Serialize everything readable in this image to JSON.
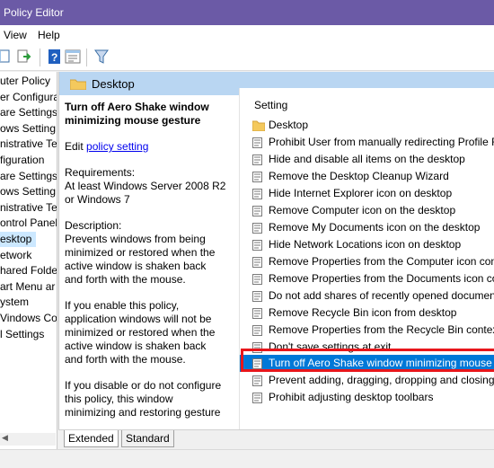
{
  "window": {
    "title": "Policy Editor"
  },
  "menu": {
    "view": "View",
    "help": "Help"
  },
  "tree": {
    "items": [
      "uter Policy",
      "er Configura",
      "are Settings",
      "ows Setting",
      "nistrative Te",
      "figuration",
      "are Settings",
      "ows Setting",
      "nistrative Te",
      "ontrol Panel",
      "esktop",
      "etwork",
      "hared Folder",
      "art Menu ar",
      "ystem",
      "Vindows Cor",
      "l Settings"
    ],
    "selected_index": 10
  },
  "header": {
    "title": "Desktop"
  },
  "description": {
    "title": "Turn off Aero Shake window minimizing mouse gesture",
    "edit_prefix": "Edit ",
    "edit_link": "policy setting",
    "requirements": "Requirements:\nAt least Windows Server 2008 R2 or Windows 7",
    "description": "Description:\nPrevents windows from being minimized or restored when the active window is shaken back and forth with the mouse.",
    "enable": "If you enable this policy, application windows will not be minimized or restored when the active window is shaken back and forth with the mouse.",
    "disable": "If you disable or do not configure this policy, this window minimizing and restoring gesture"
  },
  "list": {
    "column": "Setting",
    "folder": "Desktop",
    "rows": [
      "Prohibit User from manually redirecting Profile F",
      "Hide and disable all items on the desktop",
      "Remove the Desktop Cleanup Wizard",
      "Hide Internet Explorer icon on desktop",
      "Remove Computer icon on the desktop",
      "Remove My Documents icon on the desktop",
      "Hide Network Locations icon on desktop",
      "Remove Properties from the Computer icon cont",
      "Remove Properties from the Documents icon con",
      "Do not add shares of recently opened document",
      "Remove Recycle Bin icon from desktop",
      "Remove Properties from the Recycle Bin context",
      "Don't save settings at exit",
      "Turn off Aero Shake window minimizing mouse g",
      "Prevent adding, dragging, dropping and closing",
      "Prohibit adjusting desktop toolbars"
    ],
    "selected_index": 13
  },
  "tabs": {
    "extended": "Extended",
    "standard": "Standard"
  },
  "colors": {
    "title_bar": "#6b5aa6",
    "header": "#b9d6f2",
    "selection": "#0078d7",
    "highlight_box": "#e8161b"
  }
}
